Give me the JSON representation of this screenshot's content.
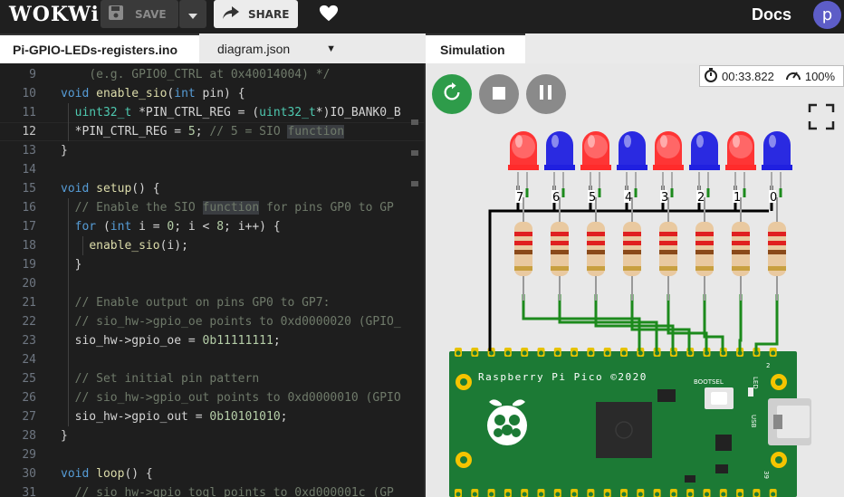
{
  "app": {
    "logo": "WOKWi",
    "save_label": "SAVE",
    "share_label": "SHARE",
    "docs_label": "Docs",
    "avatar_letter": "p"
  },
  "tabs": [
    {
      "label": "Pi-GPIO-LEDs-registers.ino",
      "active": true
    },
    {
      "label": "diagram.json",
      "active": false
    },
    {
      "label": "Simulation",
      "active": true
    }
  ],
  "editor": {
    "current_line": 12,
    "lines": [
      {
        "n": "9",
        "html": "    <span class='cmg'>(e.g. GPIO0_CTRL at 0x40014004) */</span>"
      },
      {
        "n": "10",
        "html": "<span class='kw'>void</span> <span class='fn'>enable_sio</span>(<span class='kw'>int</span> pin) {"
      },
      {
        "n": "11",
        "html": "  <span class='ty'>uint32_t</span> *PIN_CTRL_REG = (<span class='ty'>uint32_t</span>*)IO_BANK0_B"
      },
      {
        "n": "12",
        "html": "  *PIN_CTRL_REG = <span class='nm'>5</span>; <span class='cmg'>// 5 = SIO <span class='hl'>function</span></span>"
      },
      {
        "n": "13",
        "html": "}"
      },
      {
        "n": "14",
        "html": ""
      },
      {
        "n": "15",
        "html": "<span class='kw'>void</span> <span class='fn'>setup</span>() {"
      },
      {
        "n": "16",
        "html": "  <span class='cmg'>// Enable the SIO <span class='hl'>function</span> for pins GP0 to GP</span>"
      },
      {
        "n": "17",
        "html": "  <span class='kw'>for</span> (<span class='kw'>int</span> i = <span class='nm'>0</span>; i &lt; <span class='nm'>8</span>; i++) {"
      },
      {
        "n": "18",
        "html": "    <span class='fn'>enable_sio</span>(i);"
      },
      {
        "n": "19",
        "html": "  }"
      },
      {
        "n": "20",
        "html": ""
      },
      {
        "n": "21",
        "html": "  <span class='cmg'>// Enable output on pins GP0 to GP7:</span>"
      },
      {
        "n": "22",
        "html": "  <span class='cmg'>// sio_hw-&gt;gpio_oe points to 0xd0000020 (GPIO_</span>"
      },
      {
        "n": "23",
        "html": "  sio_hw-&gt;gpio_oe = <span class='nm'>0b11111111</span>;"
      },
      {
        "n": "24",
        "html": ""
      },
      {
        "n": "25",
        "html": "  <span class='cmg'>// Set initial pin pattern</span>"
      },
      {
        "n": "26",
        "html": "  <span class='cmg'>// sio_hw-&gt;gpio_out points to 0xd0000010 (GPIO</span>"
      },
      {
        "n": "27",
        "html": "  sio_hw-&gt;gpio_out = <span class='nm'>0b10101010</span>;"
      },
      {
        "n": "28",
        "html": "}"
      },
      {
        "n": "29",
        "html": ""
      },
      {
        "n": "30",
        "html": "<span class='kw'>void</span> <span class='fn'>loop</span>() {"
      },
      {
        "n": "31",
        "html": "  <span class='cmg'>// sio_hw-&gt;gpio_togl points to 0xd000001c (GP</span>"
      }
    ]
  },
  "simulation": {
    "timer": "00:33.822",
    "speed": "100%",
    "led_labels": [
      "7",
      "6",
      "5",
      "4",
      "3",
      "2",
      "1",
      "0"
    ],
    "led_colors": [
      "red",
      "blue",
      "red",
      "blue",
      "red",
      "blue",
      "red",
      "blue"
    ],
    "board_text": "Raspberry Pi Pico ©2020",
    "bootsel_label": "BOOTSEL",
    "led_label": "LED",
    "usb_label": "USB",
    "pin_label_top": "2",
    "pin_label_bottom": "39",
    "colors": {
      "red_on": "#ff2b2b",
      "blue_on": "#2020e0",
      "board_green": "#1c7a35",
      "wire_green": "#1c8a1c"
    }
  }
}
